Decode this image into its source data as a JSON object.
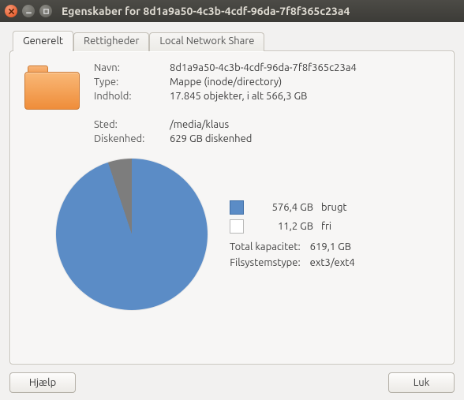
{
  "window": {
    "title": "Egenskaber for 8d1a9a50-4c3b-4cdf-96da-7f8f365c23a4"
  },
  "tabs": {
    "general": "Generelt",
    "permissions": "Rettigheder",
    "share": "Local Network Share"
  },
  "labels": {
    "name": "Navn:",
    "type": "Type:",
    "content": "Indhold:",
    "location": "Sted:",
    "volume": "Diskenhed:",
    "totalcap": "Total kapacitet:",
    "fstype": "Filsystemstype:",
    "used": "brugt",
    "free": "fri"
  },
  "values": {
    "name": "8d1a9a50-4c3b-4cdf-96da-7f8f365c23a4",
    "type": "Mappe (inode/directory)",
    "content": "17.845 objekter, i alt 566,3 GB",
    "location": "/media/klaus",
    "volume": "629 GB diskenhed",
    "used": "576,4 GB",
    "free": "11,2 GB",
    "totalcap": "619,1 GB",
    "fstype": "ext3/ext4"
  },
  "buttons": {
    "help": "Hjælp",
    "close": "Luk"
  },
  "colors": {
    "used": "#5b8cc6",
    "free": "#ffffff",
    "other": "#7d7d7d"
  },
  "chart_data": {
    "type": "pie",
    "title": "",
    "series": [
      {
        "name": "brugt",
        "value": 576.4,
        "unit": "GB",
        "color": "#5b8cc6"
      },
      {
        "name": "fri",
        "value": 11.2,
        "unit": "GB",
        "color": "#ffffff"
      },
      {
        "name": "other",
        "value": 31.5,
        "unit": "GB",
        "color": "#7d7d7d"
      }
    ],
    "total": 619.1
  }
}
